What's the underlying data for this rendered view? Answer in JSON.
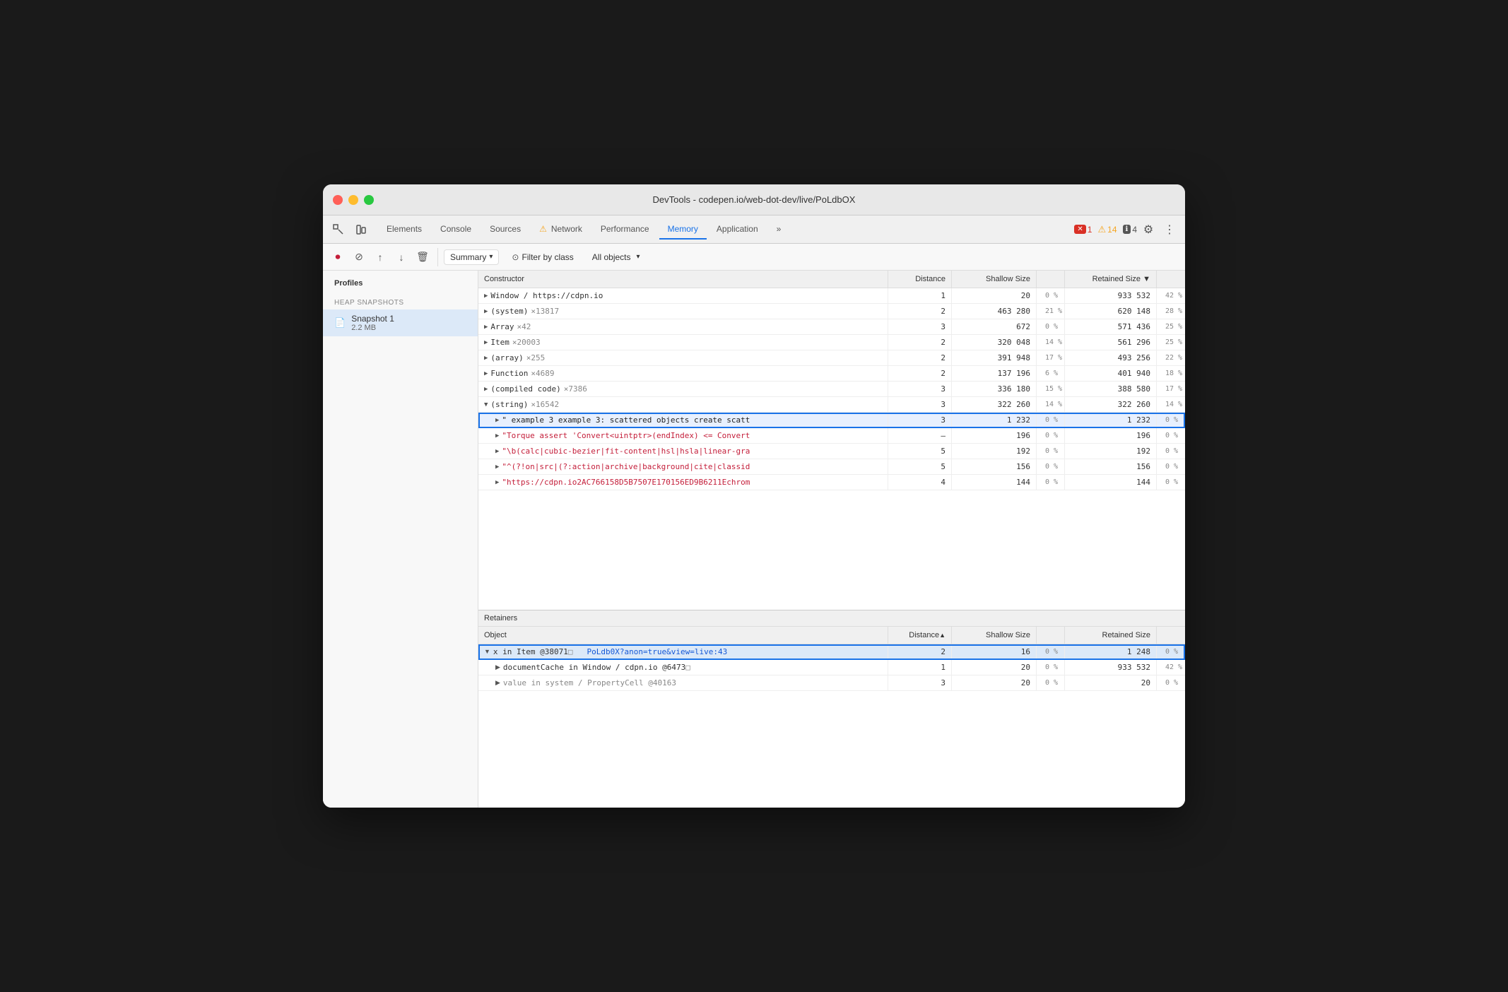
{
  "window": {
    "title": "DevTools - codepen.io/web-dot-dev/live/PoLdbOX"
  },
  "nav": {
    "tabs": [
      {
        "id": "elements",
        "label": "Elements",
        "active": false
      },
      {
        "id": "console",
        "label": "Console",
        "active": false
      },
      {
        "id": "sources",
        "label": "Sources",
        "active": false
      },
      {
        "id": "network",
        "label": "Network",
        "active": false,
        "warning": true
      },
      {
        "id": "performance",
        "label": "Performance",
        "active": false
      },
      {
        "id": "memory",
        "label": "Memory",
        "active": true
      },
      {
        "id": "application",
        "label": "Application",
        "active": false
      }
    ],
    "more_label": "»",
    "badge_error_count": "1",
    "badge_warn_count": "14",
    "badge_info_count": "4"
  },
  "toolbar": {
    "summary_label": "Summary",
    "filter_label": "Filter by class",
    "objects_label": "All objects"
  },
  "sidebar": {
    "profiles_label": "Profiles",
    "heap_snapshots_label": "HEAP SNAPSHOTS",
    "snapshot": {
      "name": "Snapshot 1",
      "size": "2.2 MB"
    }
  },
  "table": {
    "headers": {
      "constructor": "Constructor",
      "distance": "Distance",
      "shallow_size": "Shallow Size",
      "retained_size": "Retained Size"
    },
    "rows": [
      {
        "constructor": "Window / https://cdpn.io",
        "indent": 0,
        "expandable": true,
        "distance": "1",
        "shallow": "20",
        "shallow_pct": "0 %",
        "retained": "933 532",
        "retained_pct": "42 %"
      },
      {
        "constructor": "(system)",
        "count": "×13817",
        "indent": 0,
        "expandable": true,
        "distance": "2",
        "shallow": "463 280",
        "shallow_pct": "21 %",
        "retained": "620 148",
        "retained_pct": "28 %"
      },
      {
        "constructor": "Array",
        "count": "×42",
        "indent": 0,
        "expandable": true,
        "distance": "3",
        "shallow": "672",
        "shallow_pct": "0 %",
        "retained": "571 436",
        "retained_pct": "25 %"
      },
      {
        "constructor": "Item",
        "count": "×20003",
        "indent": 0,
        "expandable": true,
        "distance": "2",
        "shallow": "320 048",
        "shallow_pct": "14 %",
        "retained": "561 296",
        "retained_pct": "25 %"
      },
      {
        "constructor": "(array)",
        "count": "×255",
        "indent": 0,
        "expandable": true,
        "distance": "2",
        "shallow": "391 948",
        "shallow_pct": "17 %",
        "retained": "493 256",
        "retained_pct": "22 %"
      },
      {
        "constructor": "Function",
        "count": "×4689",
        "indent": 0,
        "expandable": true,
        "distance": "2",
        "shallow": "137 196",
        "shallow_pct": "6 %",
        "retained": "401 940",
        "retained_pct": "18 %"
      },
      {
        "constructor": "(compiled code)",
        "count": "×7386",
        "indent": 0,
        "expandable": true,
        "distance": "3",
        "shallow": "336 180",
        "shallow_pct": "15 %",
        "retained": "388 580",
        "retained_pct": "17 %"
      },
      {
        "constructor": "(string)",
        "count": "×16542",
        "indent": 0,
        "expandable": true,
        "expanded": true,
        "distance": "3",
        "shallow": "322 260",
        "shallow_pct": "14 %",
        "retained": "322 260",
        "retained_pct": "14 %"
      },
      {
        "constructor": "\" example 3 example 3: scattered objects create scatt",
        "indent": 1,
        "expandable": true,
        "string_type": true,
        "selected": true,
        "outlined": true,
        "distance": "3",
        "shallow": "1 232",
        "shallow_pct": "0 %",
        "retained": "1 232",
        "retained_pct": "0 %"
      },
      {
        "constructor": "\"Torque assert 'Convert<uintptr>(endIndex) <= Convert",
        "indent": 1,
        "expandable": true,
        "string_type": true,
        "distance": "–",
        "shallow": "196",
        "shallow_pct": "0 %",
        "retained": "196",
        "retained_pct": "0 %"
      },
      {
        "constructor": "\"\\b(calc|cubic-bezier|fit-content|hsl|hsla|linear-gra",
        "indent": 1,
        "expandable": true,
        "string_type": true,
        "distance": "5",
        "shallow": "192",
        "shallow_pct": "0 %",
        "retained": "192",
        "retained_pct": "0 %"
      },
      {
        "constructor": "\"^(?!on|src|(?:action|archive|background|cite|classid",
        "indent": 1,
        "expandable": true,
        "string_type": true,
        "distance": "5",
        "shallow": "156",
        "shallow_pct": "0 %",
        "retained": "156",
        "retained_pct": "0 %"
      },
      {
        "constructor": "\"https://cdpn.io2AC766158D5B7507E170156ED9B6211Echrom",
        "indent": 1,
        "expandable": true,
        "string_type": true,
        "distance": "4",
        "shallow": "144",
        "shallow_pct": "0 %",
        "retained": "144",
        "retained_pct": "0 %"
      }
    ]
  },
  "retainers": {
    "title": "Retainers",
    "headers": {
      "object": "Object",
      "distance": "Distance",
      "shallow_size": "Shallow Size",
      "retained_size": "Retained Size"
    },
    "rows": [
      {
        "object_prefix": "x in Item @38071",
        "link_text": "PoLdb0X?anon=true&view=live:43",
        "has_link": true,
        "selected": true,
        "outlined": true,
        "distance": "2",
        "shallow": "16",
        "shallow_pct": "0 %",
        "retained": "1 248",
        "retained_pct": "0 %"
      },
      {
        "object_prefix": "documentCache in Window / cdpn.io @6473",
        "has_link": false,
        "indent": 1,
        "distance": "1",
        "shallow": "20",
        "shallow_pct": "0 %",
        "retained": "933 532",
        "retained_pct": "42 %"
      },
      {
        "object_prefix": "value in system / PropertyCell @40163",
        "has_link": false,
        "indent": 1,
        "distance": "3",
        "shallow": "20",
        "shallow_pct": "0 %",
        "retained": "20",
        "retained_pct": "0 %"
      }
    ]
  }
}
